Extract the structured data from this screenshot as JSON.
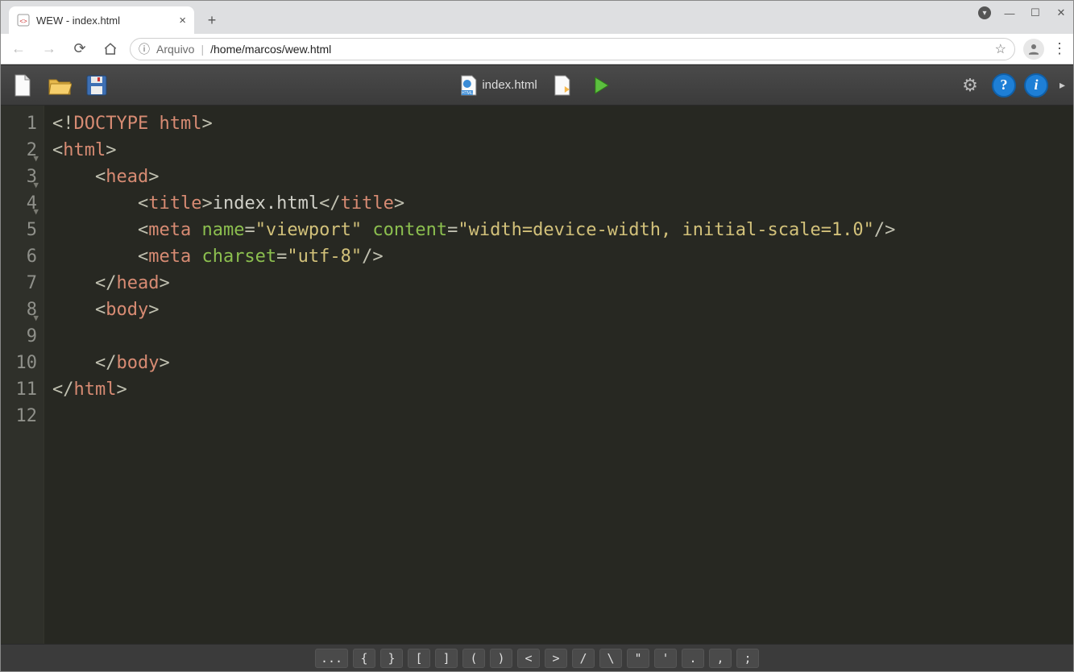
{
  "window": {
    "title": "WEW - index.html",
    "controls": {
      "chev": "▾",
      "min": "—",
      "max": "☐",
      "close": "✕"
    }
  },
  "browser": {
    "new_tab": "+",
    "nav": {
      "back": "←",
      "forward": "→",
      "reload": "⟳",
      "home": "⌂"
    },
    "addr": {
      "info": "ⓘ",
      "scheme": "Arquivo",
      "path": "/home/marcos/wew.html",
      "star": "☆"
    },
    "kebab": "⋮"
  },
  "toolbar": {
    "file_label": "index.html",
    "more": "▸"
  },
  "code": {
    "lines": [
      {
        "n": 1,
        "fold": false,
        "segs": [
          [
            "punct",
            "<!"
          ],
          [
            "salmon",
            "DOCTYPE html"
          ],
          [
            "punct",
            ">"
          ]
        ]
      },
      {
        "n": 2,
        "fold": true,
        "segs": [
          [
            "punct",
            "<"
          ],
          [
            "salmon",
            "html"
          ],
          [
            "punct",
            ">"
          ]
        ]
      },
      {
        "n": 3,
        "fold": true,
        "segs": [
          [
            "plain",
            "    "
          ],
          [
            "punct",
            "<"
          ],
          [
            "salmon",
            "head"
          ],
          [
            "punct",
            ">"
          ]
        ]
      },
      {
        "n": 4,
        "fold": true,
        "segs": [
          [
            "plain",
            "        "
          ],
          [
            "punct",
            "<"
          ],
          [
            "salmon",
            "title"
          ],
          [
            "punct",
            ">"
          ],
          [
            "plain",
            "index.html"
          ],
          [
            "punct",
            "</"
          ],
          [
            "salmon",
            "title"
          ],
          [
            "punct",
            ">"
          ]
        ]
      },
      {
        "n": 5,
        "fold": false,
        "segs": [
          [
            "plain",
            "        "
          ],
          [
            "punct",
            "<"
          ],
          [
            "salmon",
            "meta "
          ],
          [
            "green",
            "name"
          ],
          [
            "punct",
            "="
          ],
          [
            "yellow",
            "\"viewport\""
          ],
          [
            "plain",
            " "
          ],
          [
            "green",
            "content"
          ],
          [
            "punct",
            "="
          ],
          [
            "yellow",
            "\"width=device-width, initial-scale=1.0\""
          ],
          [
            "punct",
            "/>"
          ]
        ]
      },
      {
        "n": 6,
        "fold": false,
        "segs": [
          [
            "plain",
            "        "
          ],
          [
            "punct",
            "<"
          ],
          [
            "salmon",
            "meta "
          ],
          [
            "green",
            "charset"
          ],
          [
            "punct",
            "="
          ],
          [
            "yellow",
            "\"utf-8\""
          ],
          [
            "punct",
            "/>"
          ]
        ]
      },
      {
        "n": 7,
        "fold": false,
        "segs": [
          [
            "plain",
            "    "
          ],
          [
            "punct",
            "</"
          ],
          [
            "salmon",
            "head"
          ],
          [
            "punct",
            ">"
          ]
        ]
      },
      {
        "n": 8,
        "fold": true,
        "segs": [
          [
            "plain",
            "    "
          ],
          [
            "punct",
            "<"
          ],
          [
            "salmon",
            "body"
          ],
          [
            "punct",
            ">"
          ]
        ]
      },
      {
        "n": 9,
        "fold": false,
        "segs": [
          [
            "plain",
            ""
          ]
        ]
      },
      {
        "n": 10,
        "fold": false,
        "segs": [
          [
            "plain",
            "    "
          ],
          [
            "punct",
            "</"
          ],
          [
            "salmon",
            "body"
          ],
          [
            "punct",
            ">"
          ]
        ]
      },
      {
        "n": 11,
        "fold": false,
        "segs": [
          [
            "punct",
            "</"
          ],
          [
            "salmon",
            "html"
          ],
          [
            "punct",
            ">"
          ]
        ]
      },
      {
        "n": 12,
        "fold": false,
        "segs": [
          [
            "plain",
            ""
          ]
        ]
      }
    ]
  },
  "symbols": [
    "...",
    "{",
    "}",
    "[",
    "]",
    "(",
    ")",
    "<",
    ">",
    "/",
    "\\",
    "\"",
    "'",
    ".",
    ",",
    ";"
  ],
  "icons": {
    "gear": "⚙",
    "help": "?",
    "info": "i"
  }
}
